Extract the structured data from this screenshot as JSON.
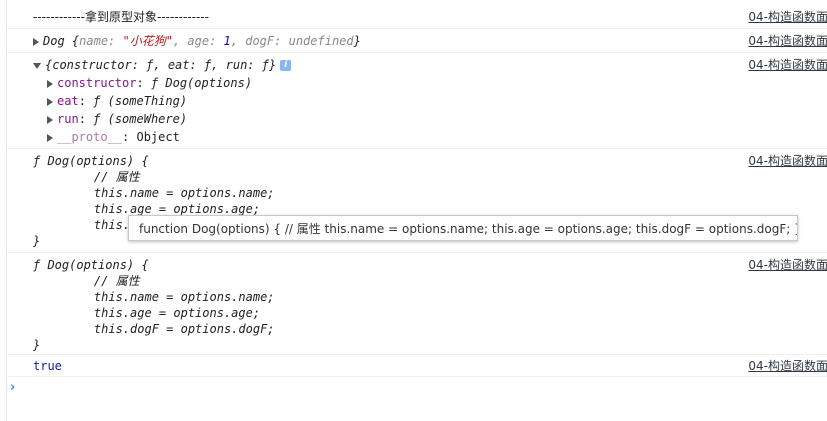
{
  "source_link": "04-构造函数面",
  "logs": {
    "heading": "------------拿到原型对象------------",
    "dog_instance": {
      "prefix": "Dog",
      "open": " {",
      "name_key": "name",
      "name_val": "\"小花狗\"",
      "age_key": "age",
      "age_val": "1",
      "dogF_key": "dogF",
      "dogF_val": "undefined",
      "close": "}"
    },
    "proto_object": {
      "summary": "{constructor: ƒ, eat: ƒ, run: ƒ}",
      "info_label": "i",
      "props": [
        {
          "key": "constructor",
          "value": "ƒ Dog(options)"
        },
        {
          "key": "eat",
          "value": "ƒ (someThing)"
        },
        {
          "key": "run",
          "value": "ƒ (someWhere)"
        },
        {
          "key": "__proto__",
          "value": "Object"
        }
      ]
    },
    "func1": {
      "lines": [
        "ƒ Dog(options) {",
        "    // 属性",
        "    this.name = options.name;",
        "    this.age = options.age;",
        "    this.",
        "}"
      ]
    },
    "func2": {
      "lines": [
        "ƒ Dog(options) {",
        "    // 属性",
        "    this.name = options.name;",
        "    this.age = options.age;",
        "    this.dogF = options.dogF;",
        "}"
      ]
    },
    "bool_result": "true"
  },
  "tooltip_text": "function Dog(options) { // 属性 this.name = options.name; this.age = options.age; this.dogF = options.dogF; }",
  "prompt_symbol": "›"
}
